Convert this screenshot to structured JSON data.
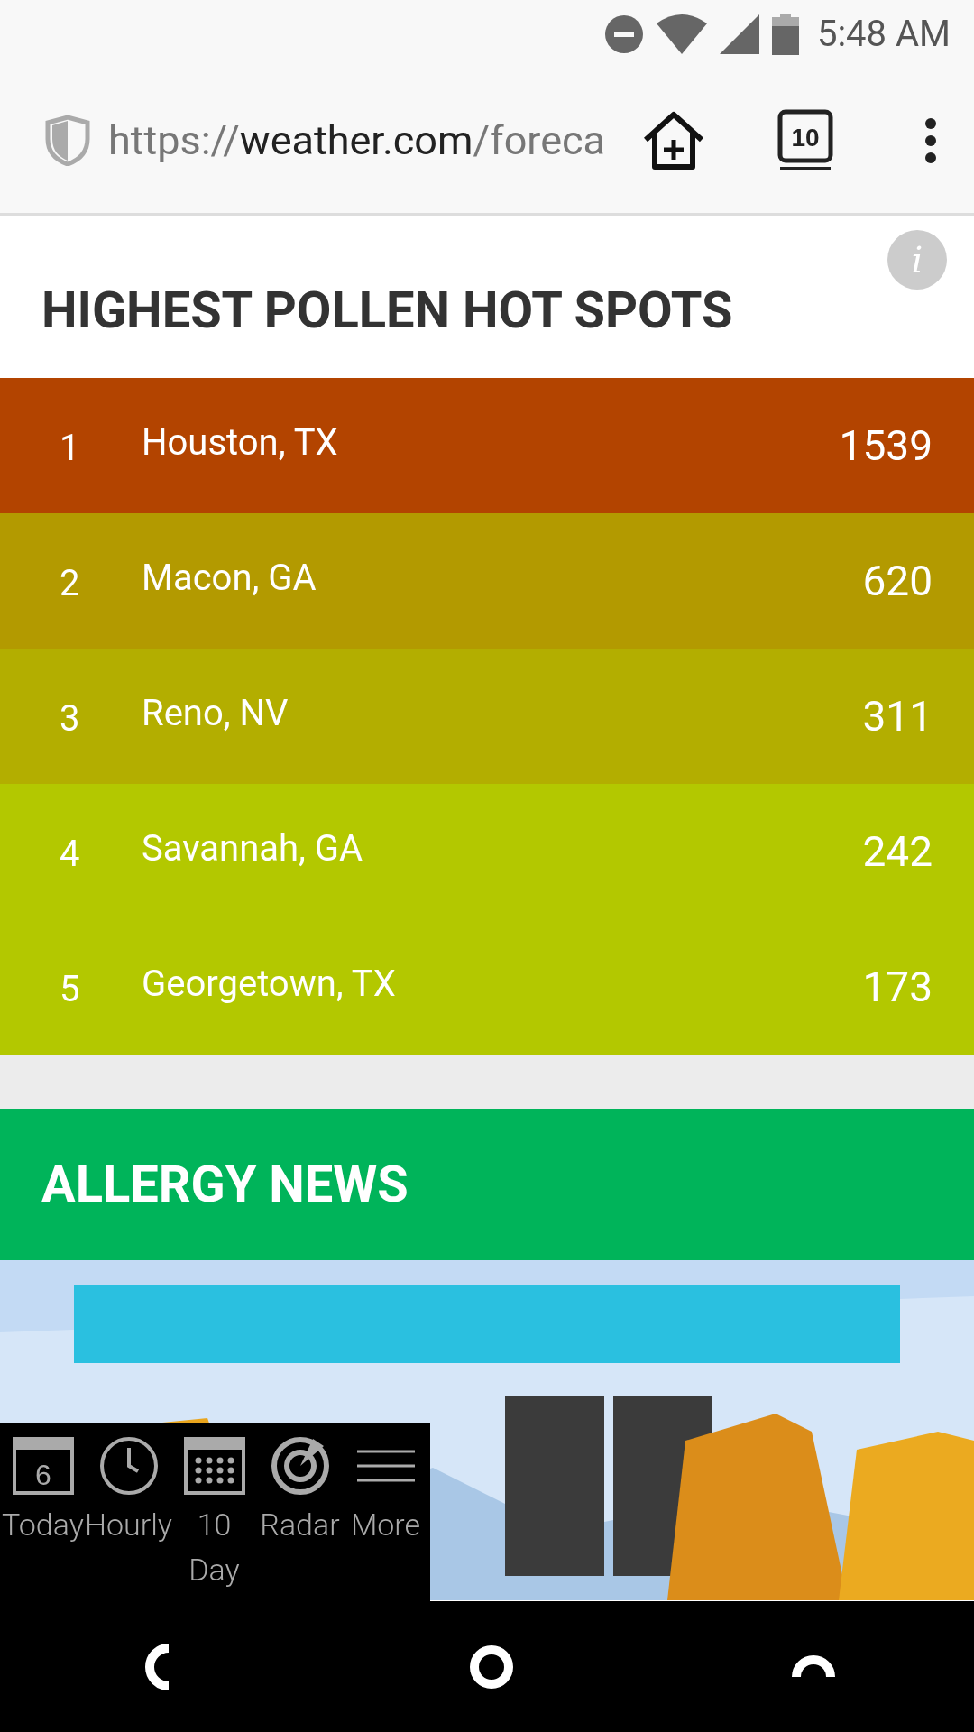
{
  "status_bar": {
    "time": "5:48 AM"
  },
  "browser": {
    "url_scheme": "https://",
    "url_host": "weather.com",
    "url_path": "/foreca",
    "tab_count": "10"
  },
  "hot_spots": {
    "title": "HIGHEST POLLEN HOT SPOTS",
    "info": "i",
    "rows": [
      {
        "rank": "1",
        "city": "Houston, TX",
        "count": "1539",
        "color": "#b34400"
      },
      {
        "rank": "2",
        "city": "Macon, GA",
        "count": "620",
        "color": "#b39a00"
      },
      {
        "rank": "3",
        "city": "Reno, NV",
        "count": "311",
        "color": "#b3ae00"
      },
      {
        "rank": "4",
        "city": "Savannah, GA",
        "count": "242",
        "color": "#b3c800"
      },
      {
        "rank": "5",
        "city": "Georgetown, TX",
        "count": "173",
        "color": "#b3c800"
      }
    ]
  },
  "news": {
    "title": "ALLERGY NEWS"
  },
  "quick_nav": [
    {
      "kind": "calendar",
      "label": "Today",
      "day": "6"
    },
    {
      "kind": "clock",
      "label": "Hourly"
    },
    {
      "kind": "grid",
      "label": "10 Day"
    },
    {
      "kind": "radar",
      "label": "Radar"
    },
    {
      "kind": "menu",
      "label": "More"
    }
  ]
}
